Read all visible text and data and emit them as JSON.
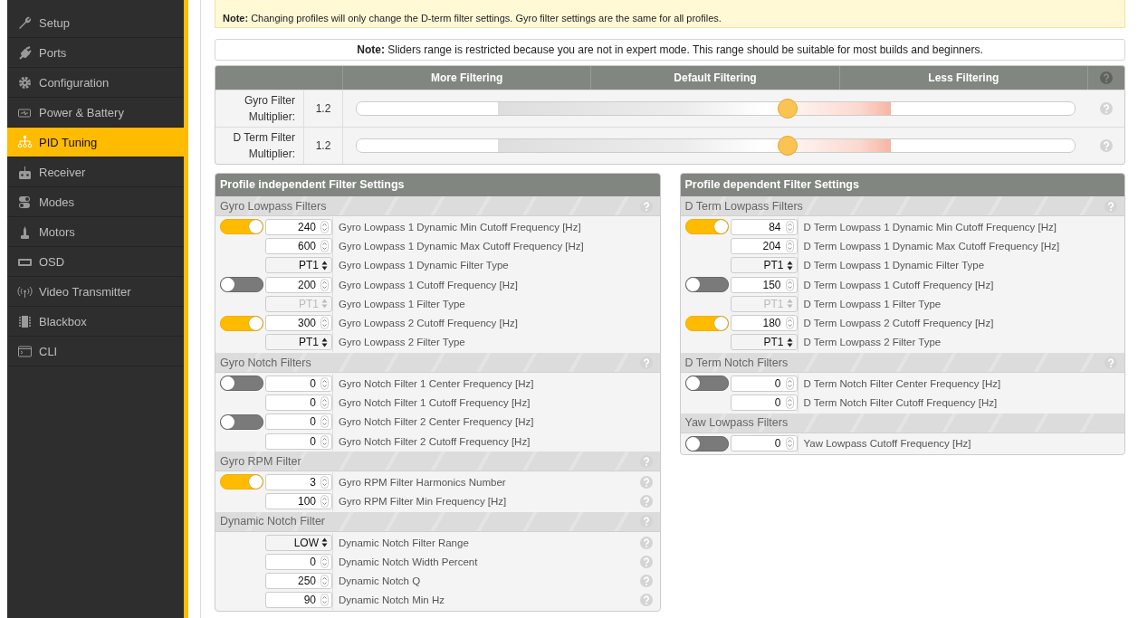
{
  "sidebar": {
    "items": [
      {
        "label": "Setup",
        "selected": false
      },
      {
        "label": "Ports",
        "selected": false
      },
      {
        "label": "Configuration",
        "selected": false
      },
      {
        "label": "Power & Battery",
        "selected": false
      },
      {
        "label": "PID Tuning",
        "selected": true
      },
      {
        "label": "Receiver",
        "selected": false
      },
      {
        "label": "Modes",
        "selected": false
      },
      {
        "label": "Motors",
        "selected": false
      },
      {
        "label": "OSD",
        "selected": false
      },
      {
        "label": "Video Transmitter",
        "selected": false
      },
      {
        "label": "Blackbox",
        "selected": false
      },
      {
        "label": "CLI",
        "selected": false
      }
    ]
  },
  "profile_note": "**Note:** Changing profiles will only change the D-term filter settings. Gyro filter settings are the same for all profiles.",
  "slider_note": "**Note:** Sliders range is restricted because you are not in expert mode. This range should be suitable for most builds and beginners.",
  "slider_table": {
    "columns": [
      "More Filtering",
      "Default Filtering",
      "Less Filtering"
    ],
    "rows": [
      {
        "label": "Gyro Filter Multiplier:",
        "value": "1.2",
        "level": 0.6
      },
      {
        "label": "D Term Filter Multiplier:",
        "value": "1.2",
        "level": 0.6
      }
    ]
  },
  "panels": [
    {
      "title": "Profile independent Filter Settings",
      "sections": [
        {
          "title": "Gyro Lowpass Filters",
          "help": true,
          "rows": [
            {
              "kind": "number",
              "switch": true,
              "on": true,
              "value": "240",
              "disabled": false,
              "label": "Gyro Lowpass 1 Dynamic Min Cutoff Frequency [Hz]",
              "help": false
            },
            {
              "kind": "number",
              "switch": false,
              "value": "600",
              "disabled": false,
              "label": "Gyro Lowpass 1 Dynamic Max Cutoff Frequency [Hz]",
              "help": false
            },
            {
              "kind": "select",
              "switch": false,
              "value": "PT1",
              "disabled": false,
              "label": "Gyro Lowpass 1 Dynamic Filter Type",
              "help": false
            },
            {
              "kind": "number",
              "switch": true,
              "on": false,
              "value": "200",
              "disabled": false,
              "label": "Gyro Lowpass 1 Cutoff Frequency [Hz]",
              "help": false
            },
            {
              "kind": "select",
              "switch": false,
              "value": "PT1",
              "disabled": true,
              "label": "Gyro Lowpass 1 Filter Type",
              "help": false
            },
            {
              "kind": "number",
              "switch": true,
              "on": true,
              "value": "300",
              "disabled": false,
              "label": "Gyro Lowpass 2 Cutoff Frequency [Hz]",
              "help": false
            },
            {
              "kind": "select",
              "switch": false,
              "value": "PT1",
              "disabled": false,
              "label": "Gyro Lowpass 2 Filter Type",
              "help": false
            }
          ]
        },
        {
          "title": "Gyro Notch Filters",
          "help": true,
          "rows": [
            {
              "kind": "number",
              "switch": true,
              "on": false,
              "value": "0",
              "disabled": false,
              "label": "Gyro Notch Filter 1 Center Frequency [Hz]",
              "help": false
            },
            {
              "kind": "number",
              "switch": false,
              "value": "0",
              "disabled": false,
              "label": "Gyro Notch Filter 1 Cutoff Frequency [Hz]",
              "help": false
            },
            {
              "kind": "number",
              "switch": true,
              "on": false,
              "value": "0",
              "disabled": false,
              "label": "Gyro Notch Filter 2 Center Frequency [Hz]",
              "help": false
            },
            {
              "kind": "number",
              "switch": false,
              "value": "0",
              "disabled": false,
              "label": "Gyro Notch Filter 2 Cutoff Frequency [Hz]",
              "help": false
            }
          ]
        },
        {
          "title": "Gyro RPM Filter",
          "help": true,
          "rows": [
            {
              "kind": "number",
              "switch": true,
              "on": true,
              "value": "3",
              "disabled": false,
              "label": "Gyro RPM Filter Harmonics Number",
              "help": true
            },
            {
              "kind": "number",
              "switch": false,
              "value": "100",
              "disabled": false,
              "label": "Gyro RPM Filter Min Frequency [Hz]",
              "help": true
            }
          ]
        },
        {
          "title": "Dynamic Notch Filter",
          "help": true,
          "rows": [
            {
              "kind": "select",
              "switch": false,
              "value": "LOW",
              "disabled": false,
              "label": "Dynamic Notch Filter Range",
              "help": true
            },
            {
              "kind": "number",
              "switch": false,
              "value": "0",
              "disabled": false,
              "label": "Dynamic Notch Width Percent",
              "help": true
            },
            {
              "kind": "number",
              "switch": false,
              "value": "250",
              "disabled": false,
              "label": "Dynamic Notch Q",
              "help": true
            },
            {
              "kind": "number",
              "switch": false,
              "value": "90",
              "disabled": false,
              "label": "Dynamic Notch Min Hz",
              "help": true
            }
          ]
        }
      ]
    },
    {
      "title": "Profile dependent Filter Settings",
      "sections": [
        {
          "title": "D Term Lowpass Filters",
          "help": true,
          "rows": [
            {
              "kind": "number",
              "switch": true,
              "on": true,
              "value": "84",
              "disabled": false,
              "label": "D Term Lowpass 1 Dynamic Min Cutoff Frequency [Hz]",
              "help": false
            },
            {
              "kind": "number",
              "switch": false,
              "value": "204",
              "disabled": false,
              "label": "D Term Lowpass 1 Dynamic Max Cutoff Frequency [Hz]",
              "help": false
            },
            {
              "kind": "select",
              "switch": false,
              "value": "PT1",
              "disabled": false,
              "label": "D Term Lowpass 1 Dynamic Filter Type",
              "help": false
            },
            {
              "kind": "number",
              "switch": true,
              "on": false,
              "value": "150",
              "disabled": false,
              "label": "D Term Lowpass 1 Cutoff Frequency [Hz]",
              "help": false
            },
            {
              "kind": "select",
              "switch": false,
              "value": "PT1",
              "disabled": true,
              "label": "D Term Lowpass 1 Filter Type",
              "help": false
            },
            {
              "kind": "number",
              "switch": true,
              "on": true,
              "value": "180",
              "disabled": false,
              "label": "D Term Lowpass 2 Cutoff Frequency [Hz]",
              "help": false
            },
            {
              "kind": "select",
              "switch": false,
              "value": "PT1",
              "disabled": false,
              "label": "D Term Lowpass 2 Filter Type",
              "help": false
            }
          ]
        },
        {
          "title": "D Term Notch Filters",
          "help": true,
          "rows": [
            {
              "kind": "number",
              "switch": true,
              "on": false,
              "value": "0",
              "disabled": false,
              "label": "D Term Notch Filter Center Frequency [Hz]",
              "help": false
            },
            {
              "kind": "number",
              "switch": false,
              "value": "0",
              "disabled": false,
              "label": "D Term Notch Filter Cutoff Frequency [Hz]",
              "help": false
            }
          ]
        },
        {
          "title": "Yaw Lowpass Filters",
          "help": false,
          "rows": [
            {
              "kind": "number",
              "switch": true,
              "on": false,
              "value": "0",
              "disabled": false,
              "label": "Yaw Lowpass Cutoff Frequency [Hz]",
              "help": false
            }
          ]
        }
      ]
    }
  ]
}
